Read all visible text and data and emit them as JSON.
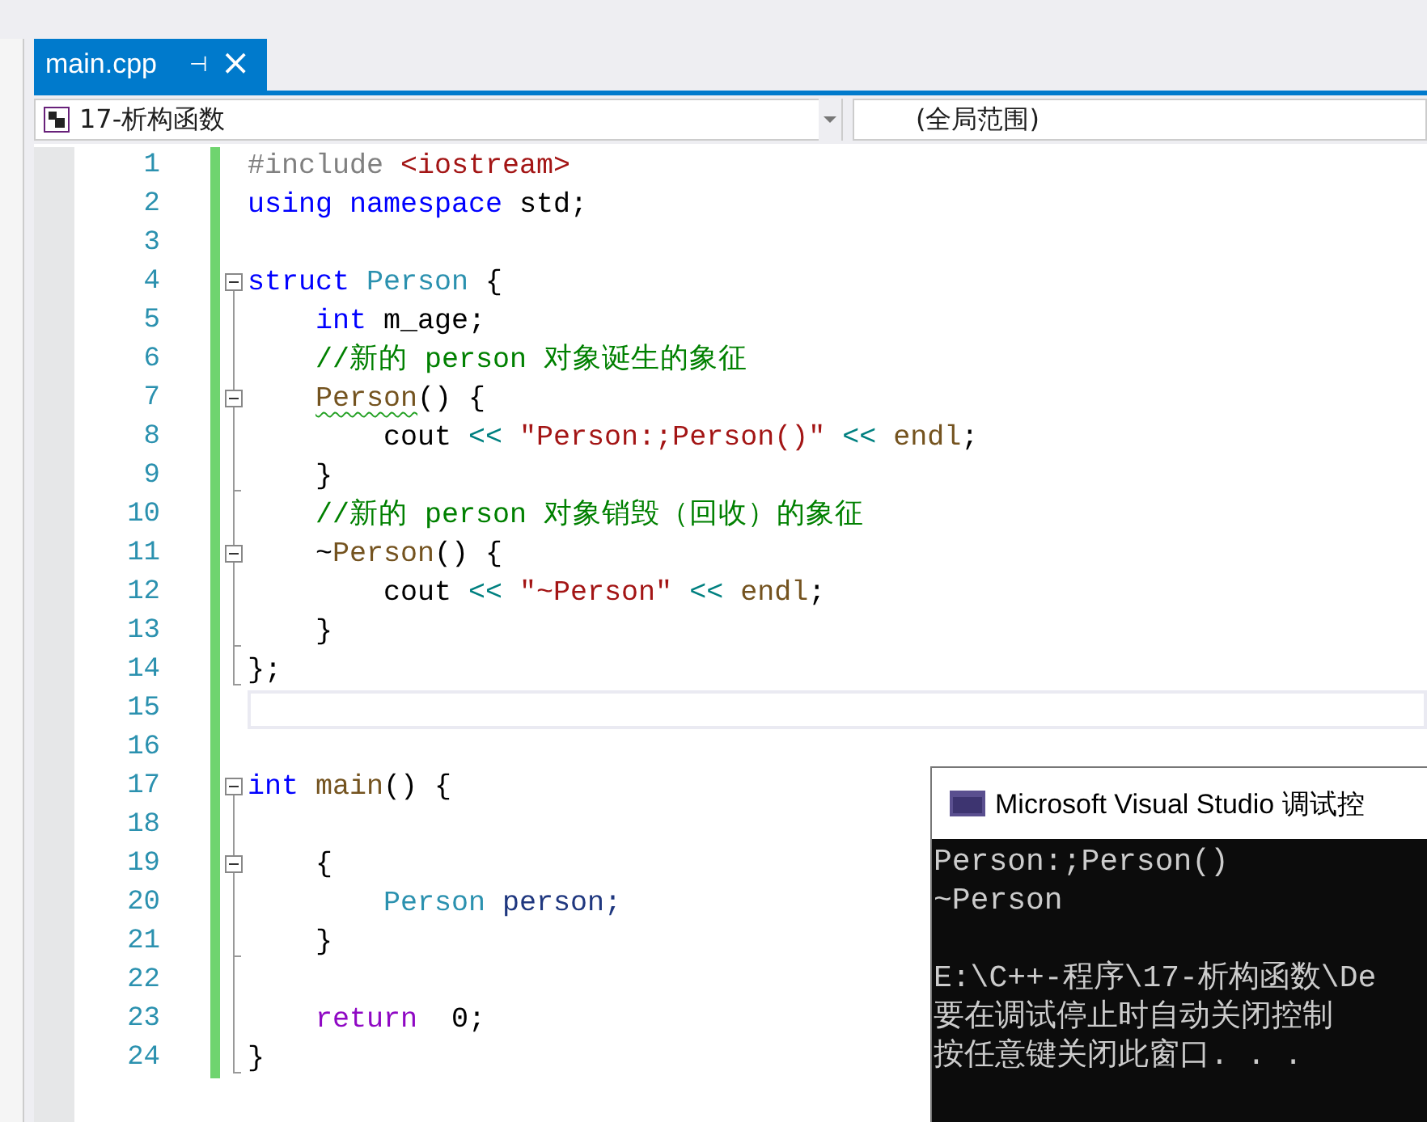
{
  "tab": {
    "title": "main.cpp",
    "pin_glyph": "⊣",
    "close_glyph": "×",
    "selected": true
  },
  "navigation": {
    "scope": "17-析构函数",
    "member": "(全局范围)"
  },
  "editor": {
    "lines": [
      {
        "number": "1",
        "tokens": [
          {
            "text": "#include ",
            "kind": "preproc"
          },
          {
            "text": "<iostream>",
            "kind": "string"
          }
        ]
      },
      {
        "number": "2",
        "tokens": [
          {
            "text": "using namespace ",
            "kind": "keyword"
          },
          {
            "text": "std;",
            "kind": "plain"
          }
        ]
      },
      {
        "number": "3"
      },
      {
        "number": "4",
        "expanded": true,
        "tokens": [
          {
            "text": "struct ",
            "kind": "keyword"
          },
          {
            "text": "Person",
            "kind": "type"
          },
          {
            "text": " {",
            "kind": "plain"
          }
        ]
      },
      {
        "number": "5",
        "tokens": [
          {
            "text": "    int ",
            "kind": "keyword"
          },
          {
            "text": "m_age;",
            "kind": "plain"
          }
        ]
      },
      {
        "number": "6",
        "tokens": [
          {
            "text": "    //新的 person 对象诞生的象征",
            "kind": "comment"
          }
        ]
      },
      {
        "number": "7",
        "expanded": true,
        "tokens": [
          {
            "text": "    Person",
            "kind": "function",
            "error": true
          },
          {
            "text": "() {",
            "kind": "plain"
          }
        ]
      },
      {
        "number": "8",
        "tokens": [
          {
            "text": "        cout ",
            "kind": "plain"
          },
          {
            "text": "<< ",
            "kind": "operator"
          },
          {
            "text": "\"Person:;Person()\"",
            "kind": "string"
          },
          {
            "text": " << ",
            "kind": "operator"
          },
          {
            "text": "endl",
            "kind": "function"
          },
          {
            "text": ";",
            "kind": "plain"
          }
        ]
      },
      {
        "number": "9",
        "block_end": true,
        "tokens": [
          {
            "text": "    }",
            "kind": "plain"
          }
        ]
      },
      {
        "number": "10",
        "tokens": [
          {
            "text": "    //新的 person 对象销毁（回收）的象征",
            "kind": "comment"
          }
        ]
      },
      {
        "number": "11",
        "expanded": true,
        "tokens": [
          {
            "text": "    ~",
            "kind": "plain"
          },
          {
            "text": "Person",
            "kind": "function"
          },
          {
            "text": "() {",
            "kind": "plain"
          }
        ]
      },
      {
        "number": "12",
        "tokens": [
          {
            "text": "        cout ",
            "kind": "plain"
          },
          {
            "text": "<< ",
            "kind": "operator"
          },
          {
            "text": "\"~Person\"",
            "kind": "string"
          },
          {
            "text": " << ",
            "kind": "operator"
          },
          {
            "text": "endl",
            "kind": "function"
          },
          {
            "text": ";",
            "kind": "plain"
          }
        ]
      },
      {
        "number": "13",
        "block_end": true,
        "tokens": [
          {
            "text": "    }",
            "kind": "plain"
          }
        ]
      },
      {
        "number": "14",
        "block_end": true,
        "tokens": [
          {
            "text": "};",
            "kind": "plain"
          }
        ]
      },
      {
        "number": "15",
        "current": true
      },
      {
        "number": "16"
      },
      {
        "number": "17",
        "expanded": true,
        "tokens": [
          {
            "text": "int ",
            "kind": "keyword"
          },
          {
            "text": "main",
            "kind": "function"
          },
          {
            "text": "() {",
            "kind": "plain"
          }
        ]
      },
      {
        "number": "18"
      },
      {
        "number": "19",
        "expanded": true,
        "tokens": [
          {
            "text": "    {",
            "kind": "plain"
          }
        ]
      },
      {
        "number": "20",
        "tokens": [
          {
            "text": "        Person ",
            "kind": "type"
          },
          {
            "text": "person;",
            "kind": "variable"
          }
        ]
      },
      {
        "number": "21",
        "block_end": true,
        "tokens": [
          {
            "text": "    }",
            "kind": "plain"
          }
        ]
      },
      {
        "number": "22"
      },
      {
        "number": "23",
        "tokens": [
          {
            "text": "    return  ",
            "kind": "control"
          },
          {
            "text": "0;",
            "kind": "plain"
          }
        ]
      },
      {
        "number": "24",
        "block_end": true,
        "tokens": [
          {
            "text": "}",
            "kind": "plain"
          }
        ]
      }
    ]
  },
  "console": {
    "title": "Microsoft Visual Studio 调试控",
    "blocks": [
      [
        "Person:;Person()",
        "~Person"
      ],
      [
        "E:\\C++-程序\\17-析构函数\\De",
        "要在调试停止时自动关闭控制",
        "按任意键关闭此窗口. . ."
      ]
    ]
  }
}
